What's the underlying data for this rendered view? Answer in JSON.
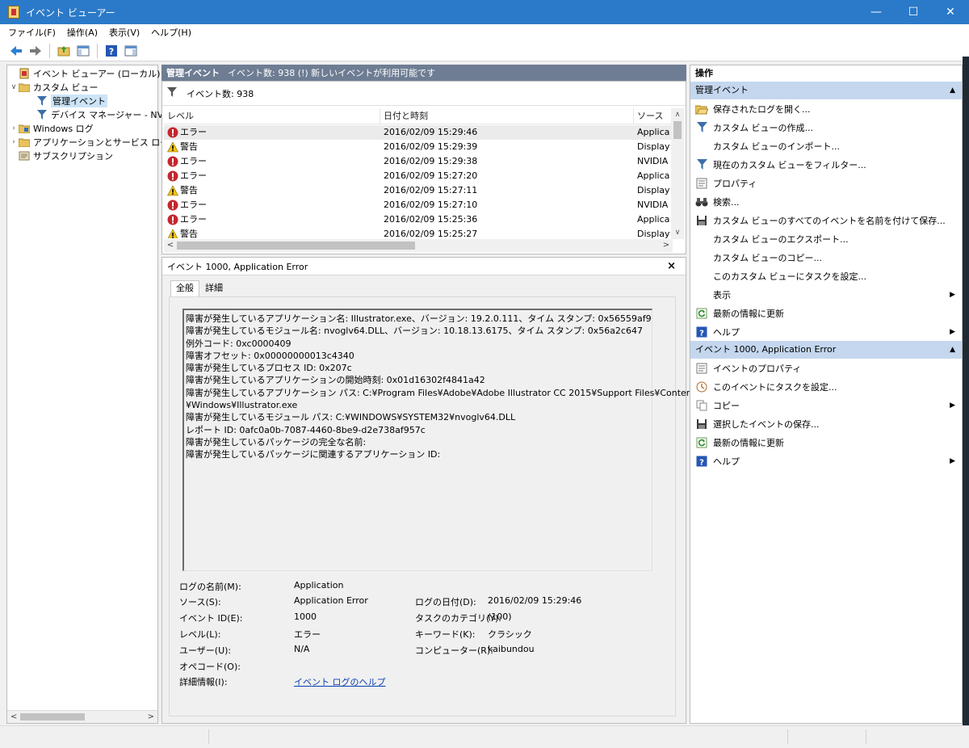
{
  "window": {
    "title": "イベント ビューアー",
    "minimize": "—",
    "maximize": "☐",
    "close": "✕"
  },
  "menu": [
    "ファイル(F)",
    "操作(A)",
    "表示(V)",
    "ヘルプ(H)"
  ],
  "tree": {
    "items": [
      {
        "label": "イベント ビューアー (ローカル)",
        "icon": "event-viewer-icon"
      },
      {
        "label": "カスタム ビュー",
        "icon": "folder-icon"
      },
      {
        "label": "管理イベント",
        "icon": "filter-icon"
      },
      {
        "label": "デバイス マネージャー - NVID",
        "icon": "filter-icon"
      },
      {
        "label": "Windows ログ",
        "icon": "folder-icon"
      },
      {
        "label": "アプリケーションとサービス ログ",
        "icon": "folder-icon"
      },
      {
        "label": "サブスクリプション",
        "icon": "subscription-icon"
      }
    ]
  },
  "center": {
    "header_title": "管理イベント",
    "header_info": "イベント数: 938 (!) 新しいイベントが利用可能です",
    "filter_label": "イベント数: 938",
    "columns": [
      "レベル",
      "日付と時刻",
      "ソース"
    ],
    "rows": [
      {
        "level": "エラー",
        "type": "error",
        "datetime": "2016/02/09 15:29:46",
        "source": "Applica"
      },
      {
        "level": "警告",
        "type": "warning",
        "datetime": "2016/02/09 15:29:39",
        "source": "Display"
      },
      {
        "level": "エラー",
        "type": "error",
        "datetime": "2016/02/09 15:29:38",
        "source": "NVIDIA"
      },
      {
        "level": "エラー",
        "type": "error",
        "datetime": "2016/02/09 15:27:20",
        "source": "Applica"
      },
      {
        "level": "警告",
        "type": "warning",
        "datetime": "2016/02/09 15:27:11",
        "source": "Display"
      },
      {
        "level": "エラー",
        "type": "error",
        "datetime": "2016/02/09 15:27:10",
        "source": "NVIDIA"
      },
      {
        "level": "エラー",
        "type": "error",
        "datetime": "2016/02/09 15:25:36",
        "source": "Applica"
      },
      {
        "level": "警告",
        "type": "warning",
        "datetime": "2016/02/09 15:25:27",
        "source": "Display"
      }
    ]
  },
  "detail": {
    "title": "イベント 1000, Application Error",
    "close": "×",
    "tabs": [
      "全般",
      "詳細"
    ],
    "description": [
      "障害が発生しているアプリケーション名: Illustrator.exe、バージョン: 19.2.0.111、タイム スタンプ: 0x56559af9",
      "障害が発生しているモジュール名: nvoglv64.DLL、バージョン: 10.18.13.6175、タイム スタンプ: 0x56a2c647",
      "例外コード: 0xc0000409",
      "障害オフセット: 0x00000000013c4340",
      "障害が発生しているプロセス ID: 0x207c",
      "障害が発生しているアプリケーションの開始時刻: 0x01d16302f4841a42",
      "障害が発生しているアプリケーション パス: C:¥Program Files¥Adobe¥Adobe Illustrator CC 2015¥Support Files¥Contents",
      "¥Windows¥Illustrator.exe",
      "障害が発生しているモジュール パス: C:¥WINDOWS¥SYSTEM32¥nvoglv64.DLL",
      "レポート ID: 0afc0a0b-7087-4460-8be9-d2e738af957c",
      "障害が発生しているパッケージの完全な名前:",
      "障害が発生しているパッケージに関連するアプリケーション ID:"
    ],
    "props": {
      "log_name_label": "ログの名前(M):",
      "log_name": "Application",
      "source_label": "ソース(S):",
      "source": "Application Error",
      "logged_label": "ログの日付(D):",
      "logged": "2016/02/09 15:29:46",
      "event_id_label": "イベント ID(E):",
      "event_id": "1000",
      "task_label": "タスクのカテゴリ(Y):",
      "task": "(100)",
      "level_label": "レベル(L):",
      "level": "エラー",
      "keywords_label": "キーワード(K):",
      "keywords": "クラシック",
      "user_label": "ユーザー(U):",
      "user": "N/A",
      "computer_label": "コンピューター(R):",
      "computer": "kaibundou",
      "opcode_label": "オペコード(O):",
      "more_info_label": "詳細情報(I):",
      "more_info_link": "イベント ログのヘルプ"
    }
  },
  "actions": {
    "title": "操作",
    "section1": "管理イベント",
    "items1": [
      {
        "label": "保存されたログを開く...",
        "icon": "open-log-icon"
      },
      {
        "label": "カスタム ビューの作成...",
        "icon": "filter-icon"
      },
      {
        "label": "カスタム ビューのインポート...",
        "icon": ""
      },
      {
        "label": "現在のカスタム ビューをフィルター...",
        "icon": "filter-icon"
      },
      {
        "label": "プロパティ",
        "icon": "properties-icon"
      },
      {
        "label": "検索...",
        "icon": "binoculars-icon"
      },
      {
        "label": "カスタム ビューのすべてのイベントを名前を付けて保存...",
        "icon": "save-icon"
      },
      {
        "label": "カスタム ビューのエクスポート...",
        "icon": ""
      },
      {
        "label": "カスタム ビューのコピー...",
        "icon": ""
      },
      {
        "label": "このカスタム ビューにタスクを設定...",
        "icon": ""
      },
      {
        "label": "表示",
        "icon": "",
        "submenu": true
      },
      {
        "label": "最新の情報に更新",
        "icon": "refresh-icon"
      },
      {
        "label": "ヘルプ",
        "icon": "help-icon",
        "submenu": true
      }
    ],
    "section2": "イベント 1000, Application Error",
    "items2": [
      {
        "label": "イベントのプロパティ",
        "icon": "properties-icon"
      },
      {
        "label": "このイベントにタスクを設定...",
        "icon": "task-icon"
      },
      {
        "label": "コピー",
        "icon": "copy-icon",
        "submenu": true
      },
      {
        "label": "選択したイベントの保存...",
        "icon": "save-icon"
      },
      {
        "label": "最新の情報に更新",
        "icon": "refresh-icon"
      },
      {
        "label": "ヘルプ",
        "icon": "help-icon",
        "submenu": true
      }
    ]
  },
  "colors": {
    "titlebar": "#2b7ac9",
    "section_header": "#c4d7ee",
    "center_header": "#6e7d93",
    "error": "#c4262e",
    "warning": "#f2c318"
  }
}
